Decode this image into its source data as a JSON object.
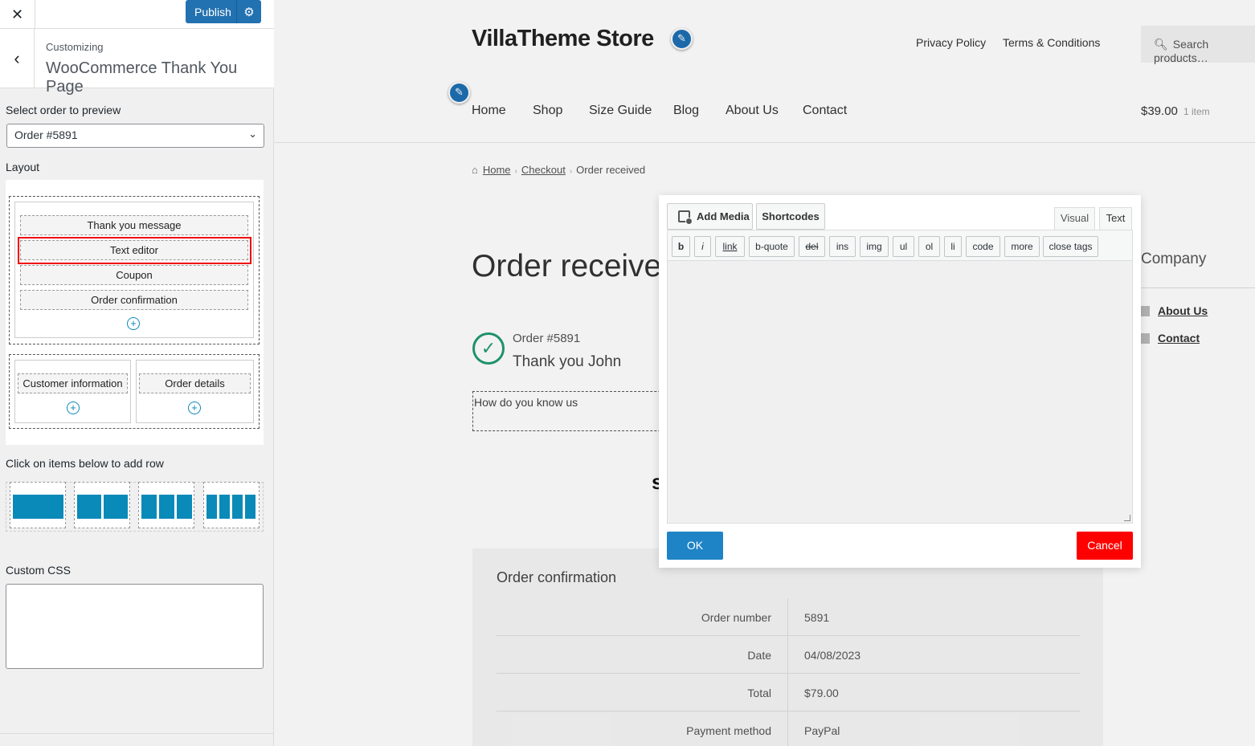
{
  "customizer": {
    "close_icon": "close-icon",
    "publish_label": "Publish",
    "settings_icon": "gear-icon",
    "back_icon": "chevron-left-icon",
    "customizing_label": "Customizing",
    "section_title": "WooCommerce Thank You Page",
    "select_order_label": "Select order to preview",
    "selected_order": "Order #5891",
    "layout_label": "Layout",
    "layout_rows": [
      {
        "items": [
          "Thank you message",
          "Text editor",
          "Coupon",
          "Order confirmation"
        ]
      },
      {
        "columns": [
          [
            "Customer information"
          ],
          [
            "Order details"
          ]
        ]
      }
    ],
    "highlighted_item": "Text editor",
    "add_row_label": "Click on items below to add row",
    "row_options": [
      "1 column",
      "2 columns",
      "3 columns",
      "4 columns"
    ],
    "custom_css_label": "Custom CSS",
    "custom_css_value": "",
    "accent_color": "#0a8ab8",
    "publish_color": "#2271b1"
  },
  "site": {
    "title": "VillaTheme Store",
    "top_links": [
      "Privacy Policy",
      "Terms & Conditions"
    ],
    "search_placeholder": "Search products…",
    "nav": [
      "Home",
      "Shop",
      "Size Guide",
      "Blog",
      "About Us",
      "Contact"
    ],
    "cart_total": "$39.00",
    "cart_count": "1 item",
    "breadcrumb": [
      "Home",
      "Checkout",
      "Order received"
    ],
    "page_title": "Order received",
    "order_number_line": "Order #5891",
    "thank_you_line": "Thank you John",
    "custom_text": "How do you know us",
    "sidebar_widget_title": "Company",
    "sidebar_links": [
      "About Us",
      "Contact"
    ],
    "confirmation": {
      "title": "Order confirmation",
      "rows": [
        {
          "label": "Order number",
          "value": "5891"
        },
        {
          "label": "Date",
          "value": "04/08/2023"
        },
        {
          "label": "Total",
          "value": "$79.00"
        },
        {
          "label": "Payment method",
          "value": "PayPal"
        }
      ]
    },
    "success_color": "#1f9a70"
  },
  "dialog": {
    "add_media_label": "Add Media",
    "shortcodes_label": "Shortcodes",
    "tab_visual": "Visual",
    "tab_text": "Text",
    "active_tab": "Text",
    "quicktags": [
      "b",
      "i",
      "link",
      "b-quote",
      "del",
      "ins",
      "img",
      "ul",
      "ol",
      "li",
      "code",
      "more",
      "close tags"
    ],
    "editor_content": "",
    "ok_label": "OK",
    "cancel_label": "Cancel",
    "ok_color": "#1f84c6",
    "cancel_color": "#ff0000"
  }
}
